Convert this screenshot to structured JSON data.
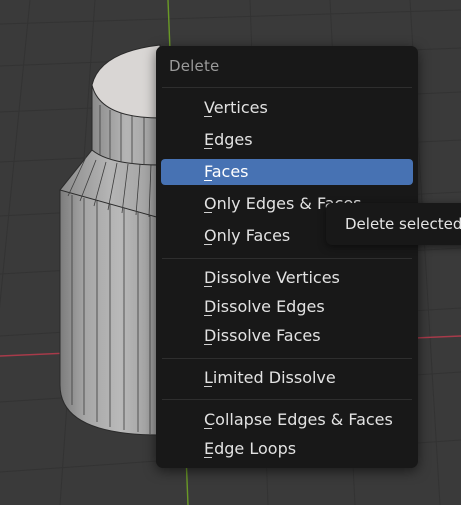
{
  "menu": {
    "title": "Delete",
    "items": [
      {
        "label": "Vertices"
      },
      {
        "label": "Edges"
      },
      {
        "label": "Faces",
        "highlighted": true
      },
      {
        "label": "Only Edges & Faces"
      },
      {
        "label": "Only Faces"
      },
      {
        "label": "Dissolve Vertices"
      },
      {
        "label": "Dissolve Edges"
      },
      {
        "label": "Dissolve Faces"
      },
      {
        "label": "Limited Dissolve"
      },
      {
        "label": "Collapse Edges & Faces"
      },
      {
        "label": "Edge Loops"
      }
    ]
  },
  "tooltip": {
    "text": "Delete selected"
  },
  "colors": {
    "viewport_bg": "#3a3a3a",
    "menu_bg": "#181818",
    "highlight": "#4772b3",
    "x_axis": "#a83a4a",
    "y_axis": "#6a9a26"
  }
}
